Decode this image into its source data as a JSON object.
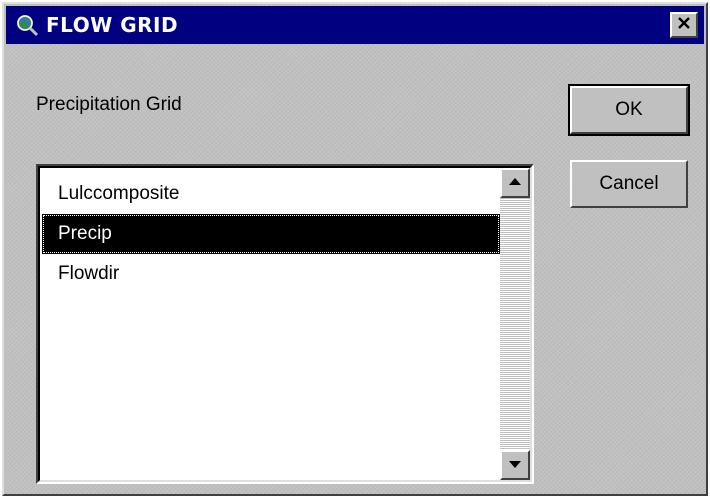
{
  "window": {
    "title": "FLOW GRID",
    "icon": "globe-magnifier-icon",
    "close_icon": "close-icon"
  },
  "prompt": {
    "label": "Precipitation Grid"
  },
  "grid_list": {
    "items": [
      {
        "label": "Lulccomposite",
        "selected": false
      },
      {
        "label": "Precip",
        "selected": true
      },
      {
        "label": "Flowdir",
        "selected": false
      }
    ],
    "scroll_up_icon": "scroll-up-arrow-icon",
    "scroll_down_icon": "scroll-down-arrow-icon"
  },
  "buttons": {
    "ok_label": "OK",
    "cancel_label": "Cancel"
  },
  "colors": {
    "titlebar": "#000080",
    "dialog_face": "#c0c0c0",
    "selection": "#000000"
  }
}
